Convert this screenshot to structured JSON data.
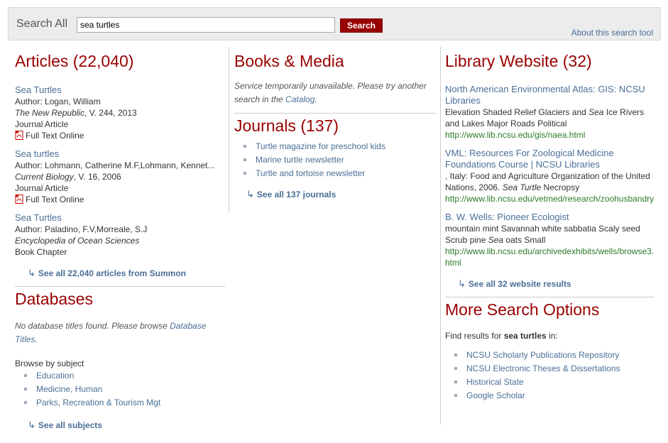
{
  "search": {
    "label": "Search All",
    "value": "sea turtles",
    "button": "Search",
    "about": "About this search tool"
  },
  "articles": {
    "heading": "Articles (22,040)",
    "items": [
      {
        "title": "Sea Turtles",
        "author": "Author: Logan, William",
        "journal": "The New Republic",
        "volume": ", V. 244, 2013",
        "type": "Journal Article",
        "fulltext": "Full Text Online"
      },
      {
        "title": "Sea turtles",
        "author": "Author: Lohmann, Catherine M.F,Lohmann, Kennet...",
        "journal": "Current Biology",
        "volume": ", V. 16, 2006",
        "type": "Journal Article",
        "fulltext": "Full Text Online"
      },
      {
        "title": "Sea Turtles",
        "author": "Author: Paladino, F.V,Morreale, S.J",
        "journal": "Encyclopedia of Ocean Sciences",
        "volume": "",
        "type": "Book Chapter"
      }
    ],
    "see_all": "See all 22,040 articles from Summon"
  },
  "databases": {
    "heading": "Databases",
    "note_text": "No database titles found. Please browse ",
    "note_link": "Database Titles",
    "note_end": ".",
    "browse_label": "Browse by subject",
    "subjects": [
      "Education",
      "Medicine, Human",
      "Parks, Recreation & Tourism Mgt"
    ],
    "see_all": "See all subjects"
  },
  "books": {
    "heading": "Books & Media",
    "note_text": "Service temporarily unavailable. Please try another search in the ",
    "note_link": "Catalog",
    "note_end": "."
  },
  "journals": {
    "heading": "Journals (137)",
    "items": [
      "Turtle magazine for preschool kids",
      "Marine turtle newsletter",
      "Turtle and tortoise newsletter"
    ],
    "see_all": "See all 137 journals"
  },
  "website": {
    "heading": "Library Website (32)",
    "items": [
      {
        "title": "North American Environmental Atlas: GIS: NCSU Libraries",
        "snippet_a": "Elevation Shaded Relief Glaciers and ",
        "snippet_em": "Sea",
        "snippet_b": " Ice Rivers and Lakes Major Roads Political",
        "url": "http://www.lib.ncsu.edu/gis/naea.html"
      },
      {
        "title": "VML: Resources For Zoological Medicine Foundations Course | NCSU Libraries",
        "snippet_a": ", Italy: Food and Agriculture Organization of the United Nations, 2006. ",
        "snippet_em": "Sea Turtle",
        "snippet_b": " Necropsy",
        "url": "http://www.lib.ncsu.edu/vetmed/research/zoohusbandry"
      },
      {
        "title": "B. W. Wells: Pioneer Ecologist",
        "snippet_a": "mountain mint Savannah white sabbatia Scaly seed Scrub pine ",
        "snippet_em": "Sea",
        "snippet_b": " oats Small",
        "url": "http://www.lib.ncsu.edu/archivedexhibits/wells/browse3.html"
      }
    ],
    "see_all": "See all 32 website results"
  },
  "more": {
    "heading": "More Search Options",
    "find_a": "Find results for ",
    "find_b": "sea turtles",
    "find_c": " in:",
    "items": [
      "NCSU Scholarly Publications Repository",
      "NCSU Electronic Theses & Dissertations",
      "Historical State",
      "Google Scholar"
    ]
  }
}
